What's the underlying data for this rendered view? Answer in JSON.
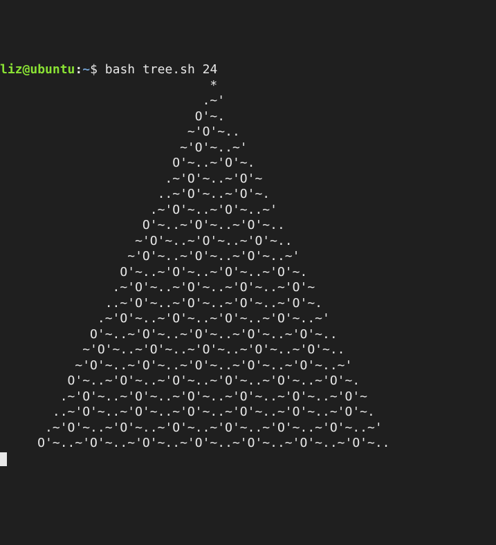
{
  "prompt": {
    "user": "liz",
    "at": "@",
    "host": "ubuntu",
    "colon": ":",
    "path": "~",
    "dollar": "$ "
  },
  "command": "bash tree.sh 24",
  "tree_lines": [
    "                            *",
    "                           .~'",
    "                          O'~.",
    "                         ~'O'~..",
    "                        ~'O'~..~'",
    "                       O'~..~'O'~.",
    "                      .~'O'~..~'O'~",
    "                     ..~'O'~..~'O'~.",
    "                    .~'O'~..~'O'~..~'",
    "                   O'~..~'O'~..~'O'~..",
    "                  ~'O'~..~'O'~..~'O'~..",
    "                 ~'O'~..~'O'~..~'O'~..~'",
    "                O'~..~'O'~..~'O'~..~'O'~.",
    "               .~'O'~..~'O'~..~'O'~..~'O'~",
    "              ..~'O'~..~'O'~..~'O'~..~'O'~.",
    "             .~'O'~..~'O'~..~'O'~..~'O'~..~'",
    "            O'~..~'O'~..~'O'~..~'O'~..~'O'~..",
    "           ~'O'~..~'O'~..~'O'~..~'O'~..~'O'~..",
    "          ~'O'~..~'O'~..~'O'~..~'O'~..~'O'~..~'",
    "         O'~..~'O'~..~'O'~..~'O'~..~'O'~..~'O'~.",
    "        .~'O'~..~'O'~..~'O'~..~'O'~..~'O'~..~'O'~",
    "       ..~'O'~..~'O'~..~'O'~..~'O'~..~'O'~..~'O'~.",
    "      .~'O'~..~'O'~..~'O'~..~'O'~..~'O'~..~'O'~..~'",
    "     O'~..~'O'~..~'O'~..~'O'~..~'O'~..~'O'~..~'O'~.."
  ]
}
